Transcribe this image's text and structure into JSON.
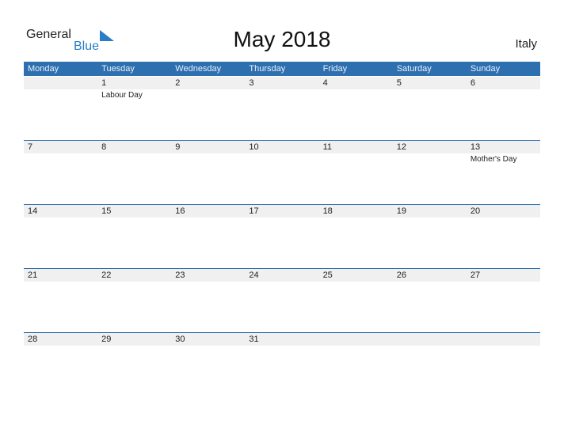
{
  "logo": {
    "general": "General",
    "blue": "Blue"
  },
  "title": "May 2018",
  "country": "Italy",
  "days": [
    "Monday",
    "Tuesday",
    "Wednesday",
    "Thursday",
    "Friday",
    "Saturday",
    "Sunday"
  ],
  "weeks": [
    [
      {
        "d": ""
      },
      {
        "d": "1",
        "e": "Labour Day"
      },
      {
        "d": "2"
      },
      {
        "d": "3"
      },
      {
        "d": "4"
      },
      {
        "d": "5"
      },
      {
        "d": "6"
      }
    ],
    [
      {
        "d": "7"
      },
      {
        "d": "8"
      },
      {
        "d": "9"
      },
      {
        "d": "10"
      },
      {
        "d": "11"
      },
      {
        "d": "12"
      },
      {
        "d": "13",
        "e": "Mother's Day"
      }
    ],
    [
      {
        "d": "14"
      },
      {
        "d": "15"
      },
      {
        "d": "16"
      },
      {
        "d": "17"
      },
      {
        "d": "18"
      },
      {
        "d": "19"
      },
      {
        "d": "20"
      }
    ],
    [
      {
        "d": "21"
      },
      {
        "d": "22"
      },
      {
        "d": "23"
      },
      {
        "d": "24"
      },
      {
        "d": "25"
      },
      {
        "d": "26"
      },
      {
        "d": "27"
      }
    ],
    [
      {
        "d": "28"
      },
      {
        "d": "29"
      },
      {
        "d": "30"
      },
      {
        "d": "31"
      },
      {
        "d": ""
      },
      {
        "d": ""
      },
      {
        "d": ""
      }
    ]
  ]
}
